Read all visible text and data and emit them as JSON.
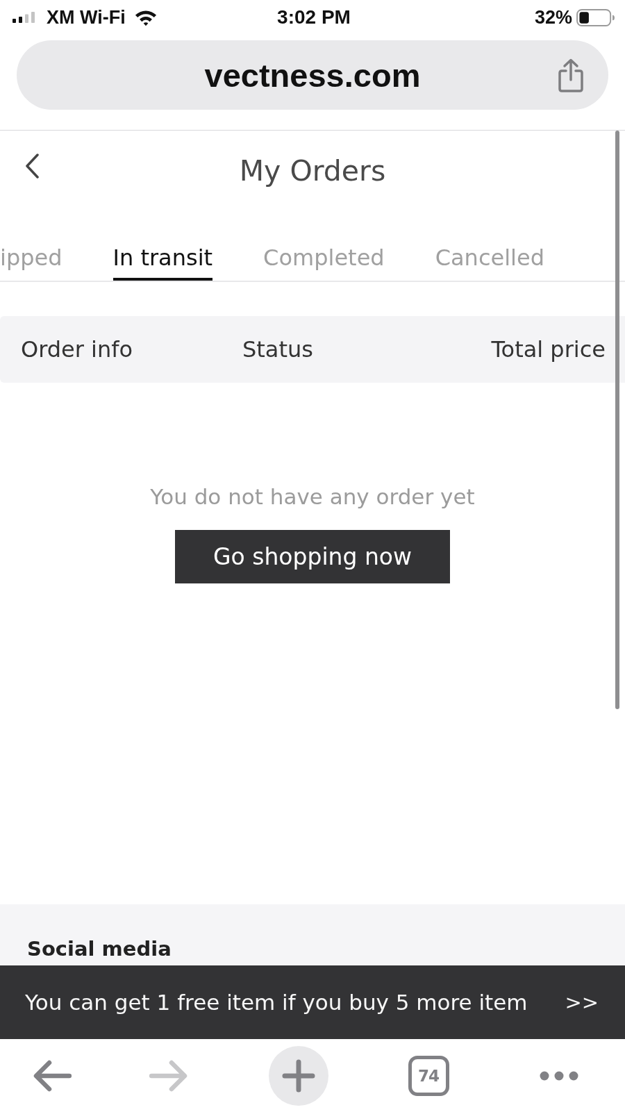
{
  "status_bar": {
    "carrier": "XM Wi-Fi",
    "time": "3:02 PM",
    "battery": "32%"
  },
  "address_bar": {
    "url": "vectness.com"
  },
  "header": {
    "title": "My Orders"
  },
  "tabs": [
    {
      "label": "ipped",
      "selected": false
    },
    {
      "label": "In transit",
      "selected": true
    },
    {
      "label": "Completed",
      "selected": false
    },
    {
      "label": "Cancelled",
      "selected": false
    }
  ],
  "table": {
    "columns": [
      "Order info",
      "Status",
      "Total price"
    ]
  },
  "empty_state": {
    "message": "You do not have any order yet",
    "button": "Go shopping now"
  },
  "footer": {
    "heading": "Social media"
  },
  "promo_banner": {
    "text": "You can get 1 free item if you buy 5 more item",
    "link": ">>"
  },
  "toolbar": {
    "buttons": [
      {
        "kind": "back",
        "disabled": false
      },
      {
        "kind": "forward",
        "disabled": true
      },
      {
        "kind": "new_tab",
        "disabled": false
      },
      {
        "kind": "tabs",
        "label": "74",
        "disabled": false
      },
      {
        "kind": "more",
        "disabled": false
      }
    ]
  }
}
